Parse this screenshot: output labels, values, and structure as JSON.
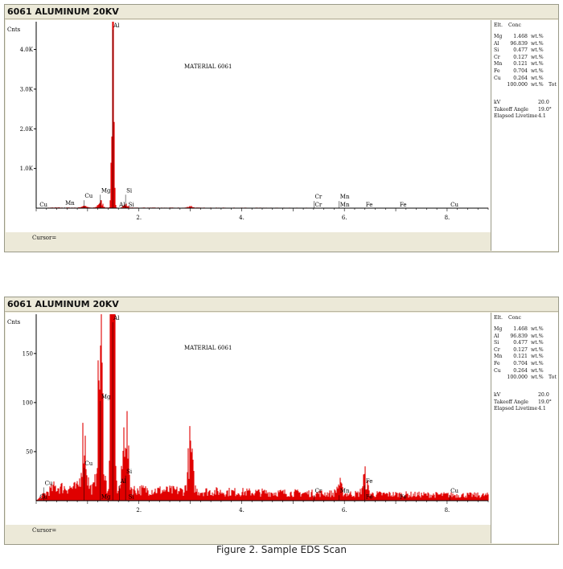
{
  "caption": "Figure 2. Sample EDS Scan",
  "colors": {
    "spectrum": "#e00000",
    "axis": "#000000",
    "panel_bg": "#ece9d8"
  },
  "panels": [
    {
      "title": "6061 ALUMINUM 20KV",
      "cursor_label": "Cursor=",
      "results": {
        "headers": [
          "Elt.",
          "Conc"
        ],
        "rows": [
          {
            "elt": "Mg",
            "conc": "1.468",
            "unit": "wt.%"
          },
          {
            "elt": "Al",
            "conc": "96.839",
            "unit": "wt.%"
          },
          {
            "elt": "Si",
            "conc": "0.477",
            "unit": "wt.%"
          },
          {
            "elt": "Cr",
            "conc": "0.127",
            "unit": "wt.%"
          },
          {
            "elt": "Mn",
            "conc": "0.121",
            "unit": "wt.%"
          },
          {
            "elt": "Fe",
            "conc": "0.704",
            "unit": "wt.%"
          },
          {
            "elt": "Cu",
            "conc": "0.264",
            "unit": "wt.%"
          }
        ],
        "total": {
          "conc": "100.000",
          "unit": "wt.%",
          "label": "Tot"
        },
        "params": [
          {
            "label": "kV",
            "value": "20.0"
          },
          {
            "label": "Takeoff Angle",
            "value": "19.0°"
          },
          {
            "label": "Elapsed Livetime",
            "value": "4.1"
          }
        ]
      }
    },
    {
      "title": "6061 ALUMINUM 20KV",
      "cursor_label": "Cursor=",
      "results": {
        "headers": [
          "Elt.",
          "Conc"
        ],
        "rows": [
          {
            "elt": "Mg",
            "conc": "1.468",
            "unit": "wt.%"
          },
          {
            "elt": "Al",
            "conc": "96.839",
            "unit": "wt.%"
          },
          {
            "elt": "Si",
            "conc": "0.477",
            "unit": "wt.%"
          },
          {
            "elt": "Cr",
            "conc": "0.127",
            "unit": "wt.%"
          },
          {
            "elt": "Mn",
            "conc": "0.121",
            "unit": "wt.%"
          },
          {
            "elt": "Fe",
            "conc": "0.704",
            "unit": "wt.%"
          },
          {
            "elt": "Cu",
            "conc": "0.264",
            "unit": "wt.%"
          }
        ],
        "total": {
          "conc": "100.000",
          "unit": "wt.%",
          "label": "Tot"
        },
        "params": [
          {
            "label": "kV",
            "value": "20.0"
          },
          {
            "label": "Takeoff Angle",
            "value": "19.0°"
          },
          {
            "label": "Elapsed Livetime",
            "value": "4.1"
          }
        ]
      }
    }
  ],
  "chart_data": [
    {
      "type": "area",
      "title": "6061 ALUMINUM 20KV",
      "annotation": "MATERIAL 6061",
      "ylabel": "Cnts",
      "xlim": [
        0,
        8.8
      ],
      "ylim": [
        0,
        4700
      ],
      "x_ticks": [
        {
          "value": 2,
          "label": "2."
        },
        {
          "value": 4,
          "label": "4."
        },
        {
          "value": 6,
          "label": "6."
        },
        {
          "value": 8,
          "label": "8."
        }
      ],
      "y_ticks": [
        {
          "value": 1000,
          "label": "1.0K"
        },
        {
          "value": 2000,
          "label": "2.0K"
        },
        {
          "value": 3000,
          "label": "3.0K"
        },
        {
          "value": 4000,
          "label": "4.0K"
        }
      ],
      "peaks": [
        {
          "x": 1.49,
          "y": 4650
        },
        {
          "x": 1.25,
          "y": 150
        },
        {
          "x": 1.74,
          "y": 75
        },
        {
          "x": 0.93,
          "y": 55
        },
        {
          "x": 3.0,
          "y": 45
        }
      ],
      "background": 12,
      "element_labels": [
        {
          "text": "Al",
          "x": 1.49,
          "y": 4700
        },
        {
          "text": "Cu",
          "x": 0.93,
          "y": 260
        },
        {
          "text": "Mg",
          "x": 1.25,
          "y": 400
        },
        {
          "text": "Si",
          "x": 1.74,
          "y": 400
        },
        {
          "text": "Cr",
          "x": 5.41,
          "y": 240
        },
        {
          "text": "Mn",
          "x": 5.9,
          "y": 240
        },
        {
          "text": "Cu",
          "x": 0.05,
          "y": 40
        },
        {
          "text": "Mn",
          "x": 0.55,
          "y": 80
        },
        {
          "text": "Al",
          "x": 1.6,
          "y": 40
        },
        {
          "text": "Si",
          "x": 1.78,
          "y": 40
        },
        {
          "text": "Cr",
          "x": 5.41,
          "y": 40
        },
        {
          "text": "Mn",
          "x": 5.9,
          "y": 40
        },
        {
          "text": "Fe",
          "x": 6.4,
          "y": 40
        },
        {
          "text": "Fe",
          "x": 7.06,
          "y": 40
        },
        {
          "text": "Cu",
          "x": 8.05,
          "y": 40
        },
        {
          "text": "Cu",
          "x": 8.9,
          "y": 40
        }
      ]
    },
    {
      "type": "area",
      "title": "6061 ALUMINUM 20KV",
      "annotation": "MATERIAL 6061",
      "ylabel": "Cnts",
      "xlim": [
        0,
        8.8
      ],
      "ylim": [
        0,
        190
      ],
      "x_ticks": [
        {
          "value": 2,
          "label": "2."
        },
        {
          "value": 4,
          "label": "4."
        },
        {
          "value": 6,
          "label": "6."
        },
        {
          "value": 8,
          "label": "8."
        }
      ],
      "y_ticks": [
        {
          "value": 50,
          "label": "50"
        },
        {
          "value": 100,
          "label": "100"
        },
        {
          "value": 150,
          "label": "150"
        }
      ],
      "peaks": [
        {
          "x": 1.49,
          "y": 4650
        },
        {
          "x": 1.25,
          "y": 150
        },
        {
          "x": 1.74,
          "y": 75
        },
        {
          "x": 0.93,
          "y": 55
        },
        {
          "x": 3.0,
          "y": 45
        },
        {
          "x": 6.4,
          "y": 18
        },
        {
          "x": 5.9,
          "y": 10
        }
      ],
      "background": 12,
      "element_labels": [
        {
          "text": "Al",
          "x": 1.49,
          "y": 190
        },
        {
          "text": "Mg",
          "x": 1.25,
          "y": 104
        },
        {
          "text": "Cu",
          "x": 0.93,
          "y": 36
        },
        {
          "text": "Si",
          "x": 1.74,
          "y": 28
        },
        {
          "text": "Al",
          "x": 1.62,
          "y": 18
        },
        {
          "text": "Fe",
          "x": 6.4,
          "y": 18
        },
        {
          "text": "Cu",
          "x": 0.05,
          "y": 2
        },
        {
          "text": "Cu",
          "x": 0.15,
          "y": 16
        },
        {
          "text": "Mg",
          "x": 1.25,
          "y": 2
        },
        {
          "text": "Si",
          "x": 1.78,
          "y": 2
        },
        {
          "text": "Cr",
          "x": 5.41,
          "y": 8
        },
        {
          "text": "Mn",
          "x": 5.9,
          "y": 8
        },
        {
          "text": "Fe",
          "x": 6.4,
          "y": 2
        },
        {
          "text": "Fe",
          "x": 7.06,
          "y": 2
        },
        {
          "text": "Cu",
          "x": 8.05,
          "y": 8
        },
        {
          "text": "Cu",
          "x": 8.9,
          "y": 2
        }
      ]
    }
  ]
}
